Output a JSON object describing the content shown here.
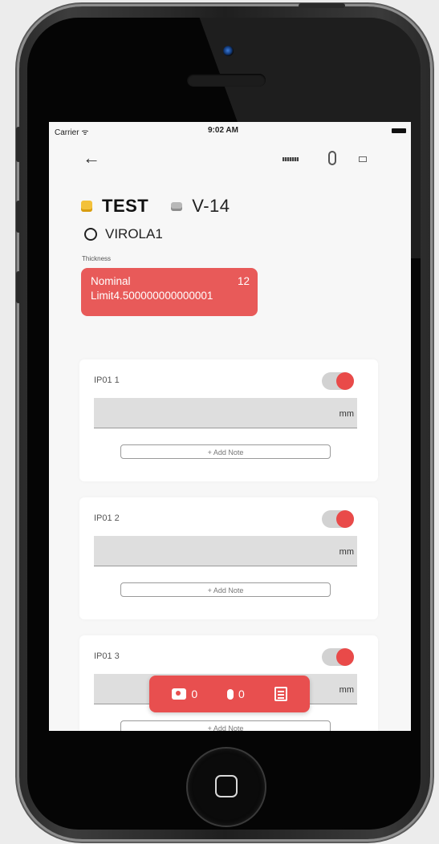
{
  "status_bar": {
    "carrier": "Carrier ᯤ",
    "time": "9:02 AM"
  },
  "toolbar": {
    "back_icon": "arrow-left-icon",
    "icons": [
      "ruler-icon",
      "paperclip-icon",
      "camcorder-icon"
    ]
  },
  "header": {
    "title": "TEST",
    "subcode": "V-14",
    "element": "VIROLA1"
  },
  "thickness": {
    "label": "Thickness",
    "nominal_label": "Nominal",
    "nominal_value": "12",
    "limit_text": "Limit4.500000000000001"
  },
  "cards": [
    {
      "label": "IP01 1",
      "unit": "mm",
      "note_button": "+ Add Note",
      "toggle_on": true
    },
    {
      "label": "IP01 2",
      "unit": "mm",
      "note_button": "+ Add Note",
      "toggle_on": true
    },
    {
      "label": "IP01 3",
      "unit": "mm",
      "note_button": "+ Add Note",
      "toggle_on": true
    }
  ],
  "action_bar": {
    "photo_count": "0",
    "audio_count": "0"
  },
  "colors": {
    "accent": "#e85a59",
    "card_bg": "#ffffff",
    "screen_bg": "#f7f7f7"
  }
}
